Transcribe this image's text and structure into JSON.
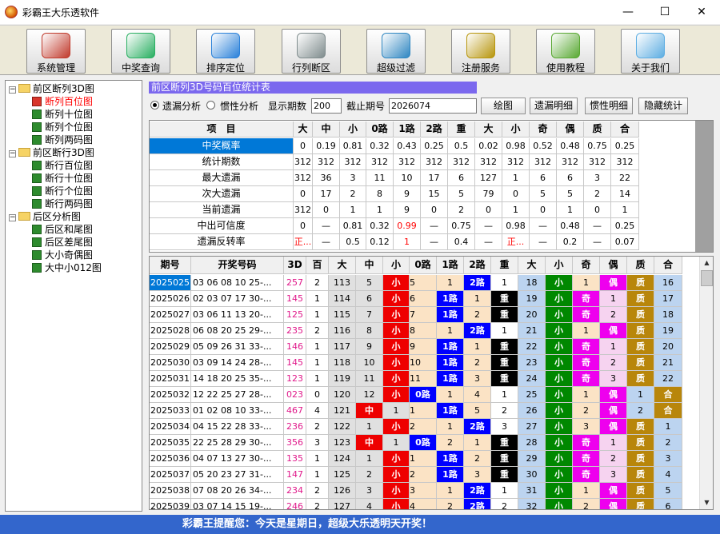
{
  "window": {
    "title": "彩霸王大乐透软件",
    "minimize": "—",
    "maximize": "☐",
    "close": "✕"
  },
  "toolbar": [
    {
      "label": "系统管理",
      "icon": "toolbox-icon",
      "color": "#c0392b"
    },
    {
      "label": "中奖查询",
      "icon": "magnifier-icon",
      "color": "#27ae60"
    },
    {
      "label": "排序定位",
      "icon": "compass-icon",
      "color": "#2980d9"
    },
    {
      "label": "行列断区",
      "icon": "notepad-icon",
      "color": "#7f8c8d"
    },
    {
      "label": "超级过滤",
      "icon": "filter-balls-icon",
      "color": "#2e86c1"
    },
    {
      "label": "注册服务",
      "icon": "keys-icon",
      "color": "#b7950b"
    },
    {
      "label": "使用教程",
      "icon": "user-icon",
      "color": "#58a832"
    },
    {
      "label": "关于我们",
      "icon": "phone-icon",
      "color": "#5dade2"
    }
  ],
  "tree": [
    {
      "label": "前区断列3D图",
      "type": "folder"
    },
    {
      "label": "断列百位图",
      "type": "leaf",
      "selected": true
    },
    {
      "label": "断列十位图",
      "type": "leaf"
    },
    {
      "label": "断列个位图",
      "type": "leaf"
    },
    {
      "label": "断列两码图",
      "type": "leaf"
    },
    {
      "label": "前区断行3D图",
      "type": "folder"
    },
    {
      "label": "断行百位图",
      "type": "leaf"
    },
    {
      "label": "断行十位图",
      "type": "leaf"
    },
    {
      "label": "断行个位图",
      "type": "leaf"
    },
    {
      "label": "断行两码图",
      "type": "leaf"
    },
    {
      "label": "后区分析图",
      "type": "folder"
    },
    {
      "label": "后区和尾图",
      "type": "leaf"
    },
    {
      "label": "后区差尾图",
      "type": "leaf"
    },
    {
      "label": "大小奇偶图",
      "type": "leaf"
    },
    {
      "label": "大中小012图",
      "type": "leaf"
    }
  ],
  "panel_title": "前区断列3D号码百位统计表",
  "options": {
    "mode1": "遗漏分析",
    "mode2": "惯性分析",
    "periods_label": "显示期数",
    "periods_value": "200",
    "end_label": "截止期号",
    "end_value": "2026074",
    "btn_plot": "绘图",
    "btn_miss": "遗漏明细",
    "btn_inertia": "惯性明细",
    "btn_hide": "隐藏统计"
  },
  "stats": {
    "headers": [
      "项　目",
      "大",
      "中",
      "小",
      "0路",
      "1路",
      "2路",
      "重",
      "大",
      "小",
      "奇",
      "偶",
      "质",
      "合"
    ],
    "rows": [
      {
        "label": "中奖概率",
        "cells": [
          "0",
          "0.19",
          "0.81",
          "0.32",
          "0.43",
          "0.25",
          "0.5",
          "0.02",
          "0.98",
          "0.52",
          "0.48",
          "0.75",
          "0.25"
        ]
      },
      {
        "label": "统计期数",
        "cells": [
          "312",
          "312",
          "312",
          "312",
          "312",
          "312",
          "312",
          "312",
          "312",
          "312",
          "312",
          "312",
          "312"
        ]
      },
      {
        "label": "最大遗漏",
        "cells": [
          "312",
          "36",
          "3",
          "11",
          "10",
          "17",
          "6",
          "127",
          "1",
          "6",
          "6",
          "3",
          "22"
        ]
      },
      {
        "label": "次大遗漏",
        "cells": [
          "0",
          "17",
          "2",
          "8",
          "9",
          "15",
          "5",
          "79",
          "0",
          "5",
          "5",
          "2",
          "14"
        ]
      },
      {
        "label": "当前遗漏",
        "cells": [
          "312",
          "0",
          "1",
          "1",
          "9",
          "0",
          "2",
          "0",
          "1",
          "0",
          "1",
          "0",
          "1"
        ]
      },
      {
        "label": "中出可信度",
        "cells": [
          "0",
          "—",
          "0.81",
          "0.32",
          "0.99",
          "—",
          "0.75",
          "—",
          "0.98",
          "—",
          "0.48",
          "—",
          "0.25"
        ]
      },
      {
        "label": "遗漏反转率",
        "cells": [
          "正...",
          "—",
          "0.5",
          "0.12",
          "1",
          "—",
          "0.4",
          "—",
          "正...",
          "—",
          "0.2",
          "—",
          "0.07"
        ]
      }
    ]
  },
  "grid": {
    "headers": [
      "期号",
      "开奖号码",
      "3D",
      "百",
      "大",
      "中",
      "小",
      "0路",
      "1路",
      "2路",
      "重",
      "大",
      "小",
      "奇",
      "偶",
      "质",
      "合"
    ],
    "rows": [
      {
        "issue": "2025025",
        "nums": "03 06 08 10 25-...",
        "d3": "257",
        "bai": "2",
        "v": [
          "113",
          "5",
          "小",
          "5",
          "1",
          "2路",
          "1",
          "18",
          "小",
          "1",
          "偶",
          "质",
          "16"
        ]
      },
      {
        "issue": "2025026",
        "nums": "02 03 07 17 30-...",
        "d3": "145",
        "bai": "1",
        "v": [
          "114",
          "6",
          "小",
          "6",
          "1路",
          "1",
          "重",
          "19",
          "小",
          "奇",
          "1",
          "质",
          "17"
        ]
      },
      {
        "issue": "2025027",
        "nums": "03 06 11 13 20-...",
        "d3": "125",
        "bai": "1",
        "v": [
          "115",
          "7",
          "小",
          "7",
          "1路",
          "2",
          "重",
          "20",
          "小",
          "奇",
          "2",
          "质",
          "18"
        ]
      },
      {
        "issue": "2025028",
        "nums": "06 08 20 25 29-...",
        "d3": "235",
        "bai": "2",
        "v": [
          "116",
          "8",
          "小",
          "8",
          "1",
          "2路",
          "1",
          "21",
          "小",
          "1",
          "偶",
          "质",
          "19"
        ]
      },
      {
        "issue": "2025029",
        "nums": "05 09 26 31 33-...",
        "d3": "146",
        "bai": "1",
        "v": [
          "117",
          "9",
          "小",
          "9",
          "1路",
          "1",
          "重",
          "22",
          "小",
          "奇",
          "1",
          "质",
          "20"
        ]
      },
      {
        "issue": "2025030",
        "nums": "03 09 14 24 28-...",
        "d3": "145",
        "bai": "1",
        "v": [
          "118",
          "10",
          "小",
          "10",
          "1路",
          "2",
          "重",
          "23",
          "小",
          "奇",
          "2",
          "质",
          "21"
        ]
      },
      {
        "issue": "2025031",
        "nums": "14 18 20 25 35-...",
        "d3": "123",
        "bai": "1",
        "v": [
          "119",
          "11",
          "小",
          "11",
          "1路",
          "3",
          "重",
          "24",
          "小",
          "奇",
          "3",
          "质",
          "22"
        ]
      },
      {
        "issue": "2025032",
        "nums": "12 22 25 27 28-...",
        "d3": "023",
        "bai": "0",
        "v": [
          "120",
          "12",
          "小",
          "0路",
          "1",
          "4",
          "1",
          "25",
          "小",
          "1",
          "偶",
          "1",
          "合"
        ]
      },
      {
        "issue": "2025033",
        "nums": "01 02 08 10 33-...",
        "d3": "467",
        "bai": "4",
        "v": [
          "121",
          "中",
          "1",
          "1",
          "1路",
          "5",
          "2",
          "26",
          "小",
          "2",
          "偶",
          "2",
          "合"
        ]
      },
      {
        "issue": "2025034",
        "nums": "04 15 22 28 33-...",
        "d3": "236",
        "bai": "2",
        "v": [
          "122",
          "1",
          "小",
          "2",
          "1",
          "2路",
          "3",
          "27",
          "小",
          "3",
          "偶",
          "质",
          "1"
        ]
      },
      {
        "issue": "2025035",
        "nums": "22 25 28 29 30-...",
        "d3": "356",
        "bai": "3",
        "v": [
          "123",
          "中",
          "1",
          "0路",
          "2",
          "1",
          "重",
          "28",
          "小",
          "奇",
          "1",
          "质",
          "2"
        ]
      },
      {
        "issue": "2025036",
        "nums": "04 07 13 27 30-...",
        "d3": "135",
        "bai": "1",
        "v": [
          "124",
          "1",
          "小",
          "1",
          "1路",
          "2",
          "重",
          "29",
          "小",
          "奇",
          "2",
          "质",
          "3"
        ]
      },
      {
        "issue": "2025037",
        "nums": "05 20 23 27 31-...",
        "d3": "147",
        "bai": "1",
        "v": [
          "125",
          "2",
          "小",
          "2",
          "1路",
          "3",
          "重",
          "30",
          "小",
          "奇",
          "3",
          "质",
          "4"
        ]
      },
      {
        "issue": "2025038",
        "nums": "07 08 20 26 34-...",
        "d3": "234",
        "bai": "2",
        "v": [
          "126",
          "3",
          "小",
          "3",
          "1",
          "2路",
          "1",
          "31",
          "小",
          "1",
          "偶",
          "质",
          "5"
        ]
      },
      {
        "issue": "2025039",
        "nums": "03 07 14 15 19-...",
        "d3": "246",
        "bai": "2",
        "v": [
          "127",
          "4",
          "小",
          "4",
          "2",
          "2路",
          "2",
          "32",
          "小",
          "2",
          "偶",
          "质",
          "6"
        ]
      }
    ]
  },
  "status": "彩霸王提醒您：今天是星期日，超级大乐透明天开奖！",
  "colors": {
    "red_cell": "#ee0000",
    "blue_cell": "#0000ff",
    "black_cell": "#000000",
    "green_cell": "#008800",
    "magenta_cell": "#ee00ee",
    "olive_cell": "#b8860b",
    "selected_row_bg": "#0078d7",
    "beige": "#fbe3c5",
    "light_blue": "#bcd4f0",
    "light_green": "#c8f5c8",
    "light_pink": "#f6d3f0",
    "light_gray": "#e0e0e0",
    "status_bar": "#3366cc"
  }
}
